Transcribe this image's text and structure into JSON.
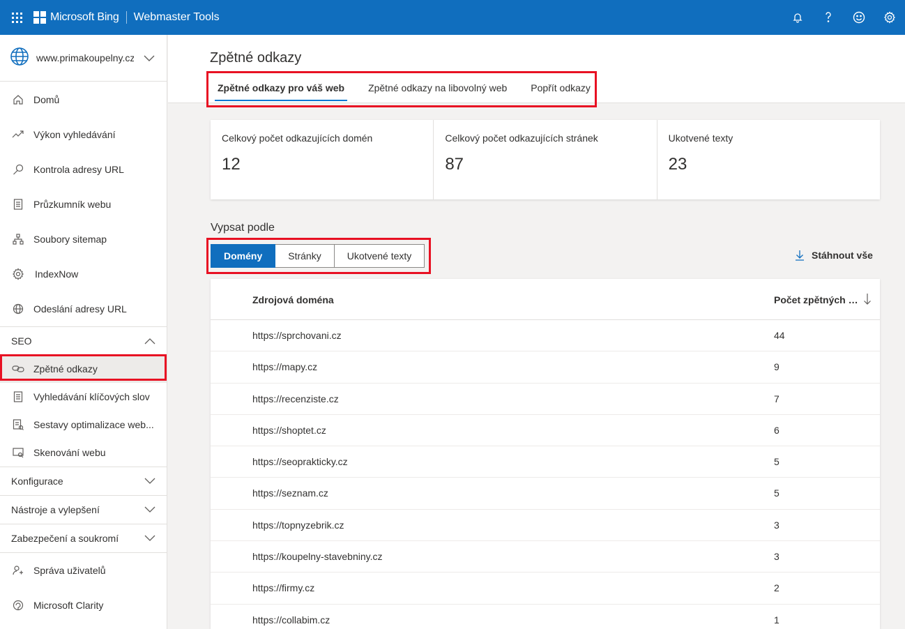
{
  "topbar": {
    "brand": "Microsoft Bing",
    "product": "Webmaster Tools",
    "icons": [
      "notification-bell-icon",
      "help-icon",
      "feedback-smiley-icon",
      "settings-gear-icon"
    ]
  },
  "sidebar": {
    "site": "www.primakoupelny.cz",
    "items": [
      {
        "label": "Domů",
        "icon": "home-icon"
      },
      {
        "label": "Výkon vyhledávání",
        "icon": "trend-icon"
      },
      {
        "label": "Kontrola adresy URL",
        "icon": "search-icon"
      },
      {
        "label": "Průzkumník webu",
        "icon": "document-icon"
      },
      {
        "label": "Soubory sitemap",
        "icon": "sitemap-icon"
      },
      {
        "label": "IndexNow",
        "icon": "gear-icon"
      },
      {
        "label": "Odeslání adresy URL",
        "icon": "globe-icon"
      }
    ],
    "seo_section": "SEO",
    "seo_items": [
      {
        "label": "Zpětné odkazy",
        "icon": "link-icon"
      },
      {
        "label": "Vyhledávání klíčových slov",
        "icon": "document-icon"
      },
      {
        "label": "Sestavy optimalizace web...",
        "icon": "report-icon"
      },
      {
        "label": "Skenování webu",
        "icon": "scan-icon"
      }
    ],
    "sections": [
      "Konfigurace",
      "Nástroje a vylepšení",
      "Zabezpečení a soukromí"
    ],
    "bottom_items": [
      {
        "label": "Správa uživatelů",
        "icon": "users-icon"
      },
      {
        "label": "Microsoft Clarity",
        "icon": "clarity-icon"
      }
    ]
  },
  "page": {
    "title": "Zpětné odkazy",
    "tabs": [
      "Zpětné odkazy pro váš web",
      "Zpětné odkazy na libovolný web",
      "Popřít odkazy"
    ]
  },
  "stats": [
    {
      "label": "Celkový počet odkazujících domén",
      "value": "12"
    },
    {
      "label": "Celkový počet odkazujících stránek",
      "value": "87"
    },
    {
      "label": "Ukotvené texty",
      "value": "23"
    }
  ],
  "list_by": {
    "label": "Vypsat podle",
    "options": [
      "Domény",
      "Stránky",
      "Ukotvené texty"
    ],
    "download": "Stáhnout vše"
  },
  "table": {
    "col_domain": "Zdrojová doména",
    "col_count": "Počet zpětných o...",
    "rows": [
      {
        "domain": "https://sprchovani.cz",
        "count": "44"
      },
      {
        "domain": "https://mapy.cz",
        "count": "9"
      },
      {
        "domain": "https://recenziste.cz",
        "count": "7"
      },
      {
        "domain": "https://shoptet.cz",
        "count": "6"
      },
      {
        "domain": "https://seoprakticky.cz",
        "count": "5"
      },
      {
        "domain": "https://seznam.cz",
        "count": "5"
      },
      {
        "domain": "https://topnyzebrik.cz",
        "count": "3"
      },
      {
        "domain": "https://koupelny-stavebniny.cz",
        "count": "3"
      },
      {
        "domain": "https://firmy.cz",
        "count": "2"
      },
      {
        "domain": "https://collabim.cz",
        "count": "1"
      }
    ]
  },
  "colors": {
    "accent": "#106ebe",
    "highlight": "#e81123"
  }
}
